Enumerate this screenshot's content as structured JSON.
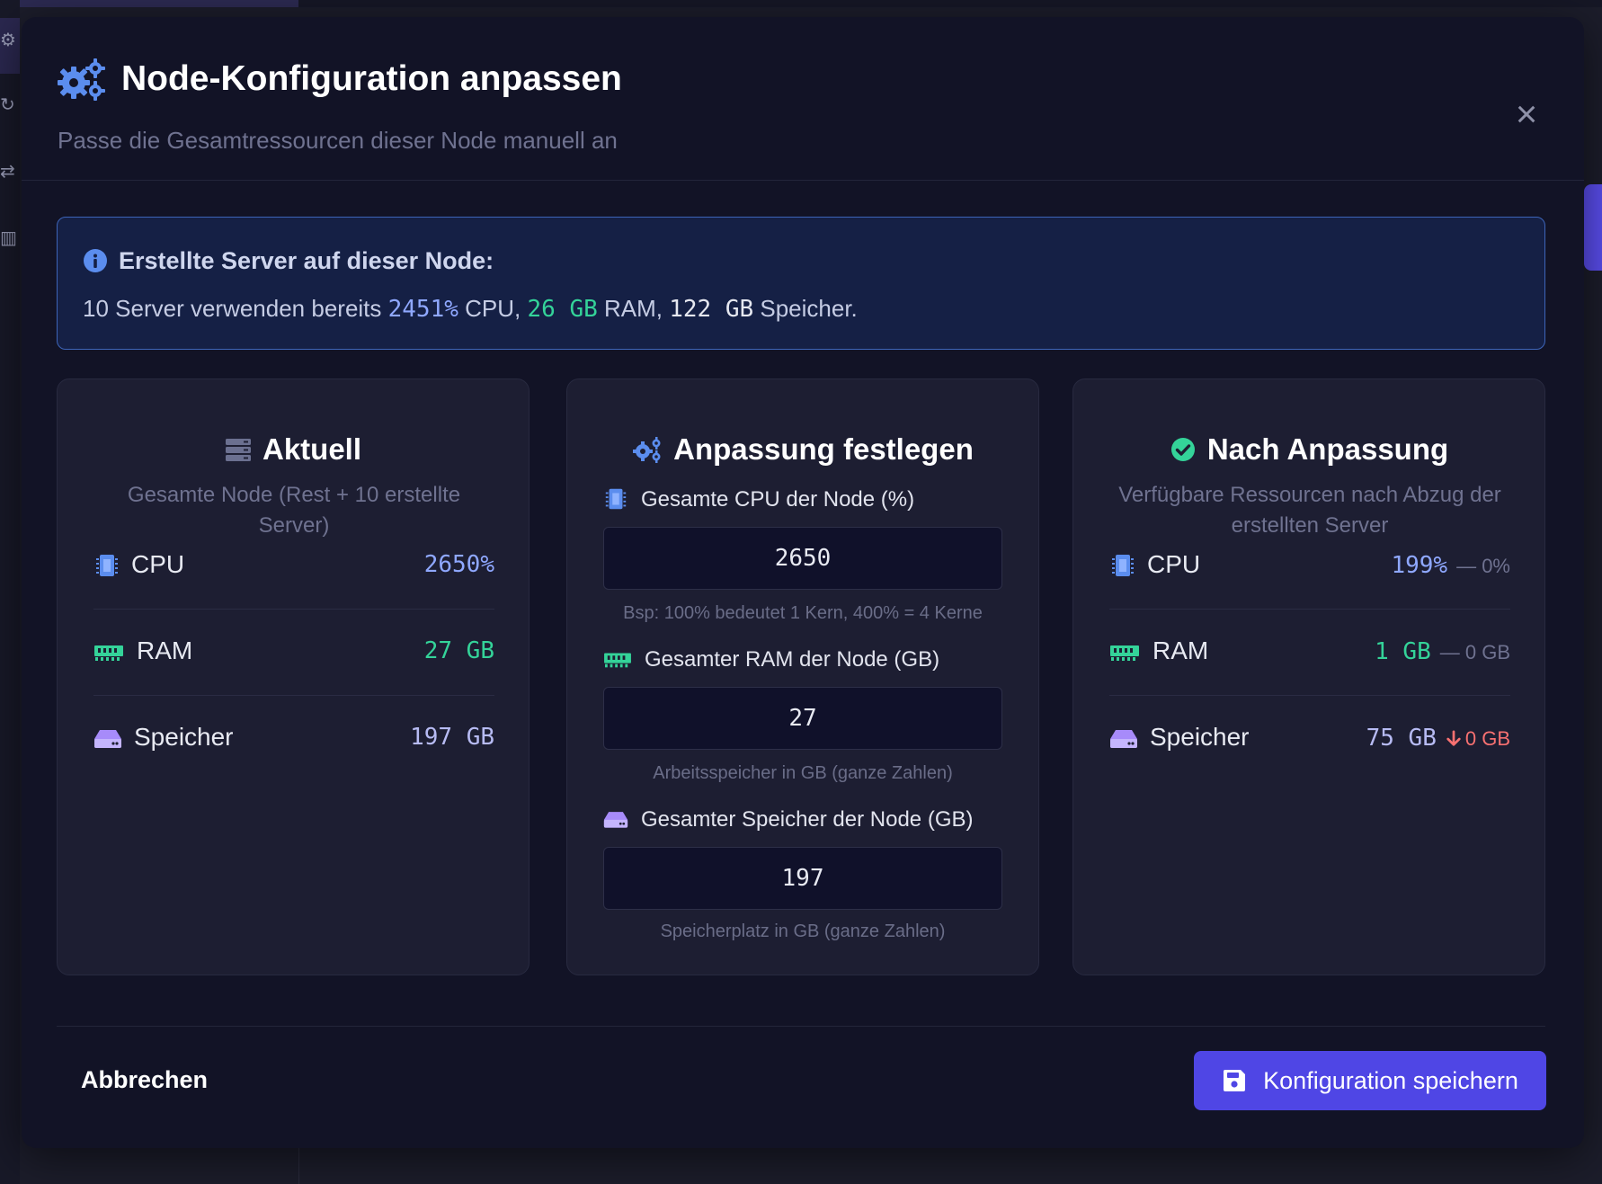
{
  "modal": {
    "title": "Node-Konfiguration anpassen",
    "subtitle": "Passe die Gesamtressourcen dieser Node manuell an",
    "close_label": "×"
  },
  "info": {
    "title": "Erstellte Server auf dieser Node:",
    "text_prefix": "10 Server verwenden bereits ",
    "cpu": "2451%",
    "cpu_suffix": " CPU, ",
    "ram": "26 GB",
    "ram_suffix": " RAM, ",
    "disk": "122 GB",
    "disk_suffix": " Speicher."
  },
  "current": {
    "title": "Aktuell",
    "subtitle": "Gesamte Node (Rest + 10 erstellte Server)",
    "rows": [
      {
        "label": "CPU",
        "value": "2650%"
      },
      {
        "label": "RAM",
        "value": "27 GB"
      },
      {
        "label": "Speicher",
        "value": "197 GB"
      }
    ]
  },
  "adjust": {
    "title": "Anpassung festlegen",
    "fields": [
      {
        "label": "Gesamte CPU der Node (%)",
        "value": "2650",
        "help": "Bsp: 100% bedeutet 1 Kern, 400% = 4 Kerne"
      },
      {
        "label": "Gesamter RAM der Node (GB)",
        "value": "27",
        "help": "Arbeitsspeicher in GB (ganze Zahlen)"
      },
      {
        "label": "Gesamter Speicher der Node (GB)",
        "value": "197",
        "help": "Speicherplatz in GB (ganze Zahlen)"
      }
    ]
  },
  "after": {
    "title": "Nach Anpassung",
    "subtitle": "Verfügbare Ressourcen nach Abzug der erstellten Server",
    "rows": [
      {
        "label": "CPU",
        "value": "199%",
        "delta": "— 0%",
        "delta_status": "neutral"
      },
      {
        "label": "RAM",
        "value": "1 GB",
        "delta": "— 0 GB",
        "delta_status": "neutral"
      },
      {
        "label": "Speicher",
        "value": "75 GB",
        "delta": "0 GB",
        "delta_status": "down"
      }
    ]
  },
  "footer": {
    "cancel_label": "Abbrechen",
    "save_label": "Konfiguration speichern"
  },
  "icons": {
    "title": "gears-icon",
    "close": "close-icon",
    "info": "info-circle-icon",
    "current": "server-icon",
    "adjust": "gears-icon",
    "after": "check-circle-icon",
    "cpu": "microchip-icon",
    "ram": "memory-icon",
    "disk": "hdd-icon",
    "save": "floppy-disk-icon"
  },
  "colors": {
    "accent": "#4f46e5",
    "cpu": "#8fa8ff",
    "ram": "#34d399",
    "disk": "#a78bfa",
    "danger": "#f87171",
    "info_border": "#3d64b8"
  }
}
